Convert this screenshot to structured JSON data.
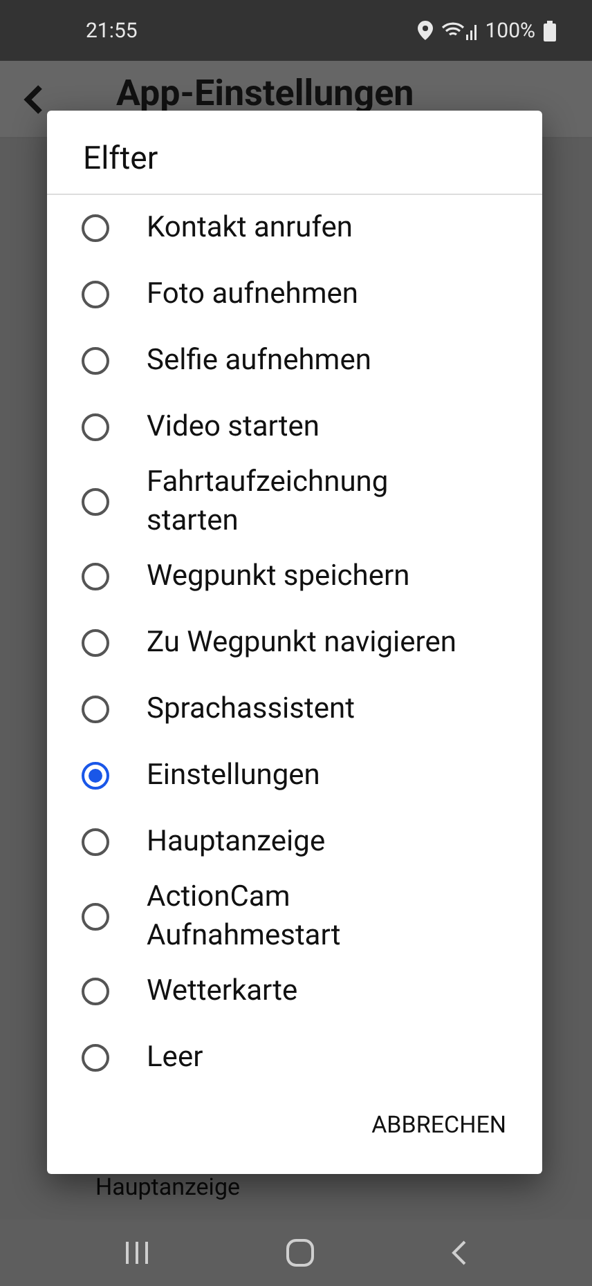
{
  "status_bar": {
    "time": "21:55",
    "battery": "100%"
  },
  "header": {
    "title": "App-Einstellungen"
  },
  "background": {
    "value": "Hauptanzeige"
  },
  "dialog": {
    "title": "Elfter",
    "options": [
      {
        "label": "Kontakt anrufen",
        "selected": false
      },
      {
        "label": "Foto aufnehmen",
        "selected": false
      },
      {
        "label": "Selfie aufnehmen",
        "selected": false
      },
      {
        "label": "Video starten",
        "selected": false
      },
      {
        "label": "Fahrtaufzeichnung starten",
        "selected": false
      },
      {
        "label": "Wegpunkt speichern",
        "selected": false
      },
      {
        "label": "Zu Wegpunkt navigieren",
        "selected": false
      },
      {
        "label": "Sprachassistent",
        "selected": false
      },
      {
        "label": "Einstellungen",
        "selected": true
      },
      {
        "label": "Hauptanzeige",
        "selected": false
      },
      {
        "label": "ActionCam Aufnahmestart",
        "selected": false
      },
      {
        "label": "Wetterkarte",
        "selected": false
      },
      {
        "label": "Leer",
        "selected": false
      }
    ],
    "cancel": "ABBRECHEN"
  }
}
